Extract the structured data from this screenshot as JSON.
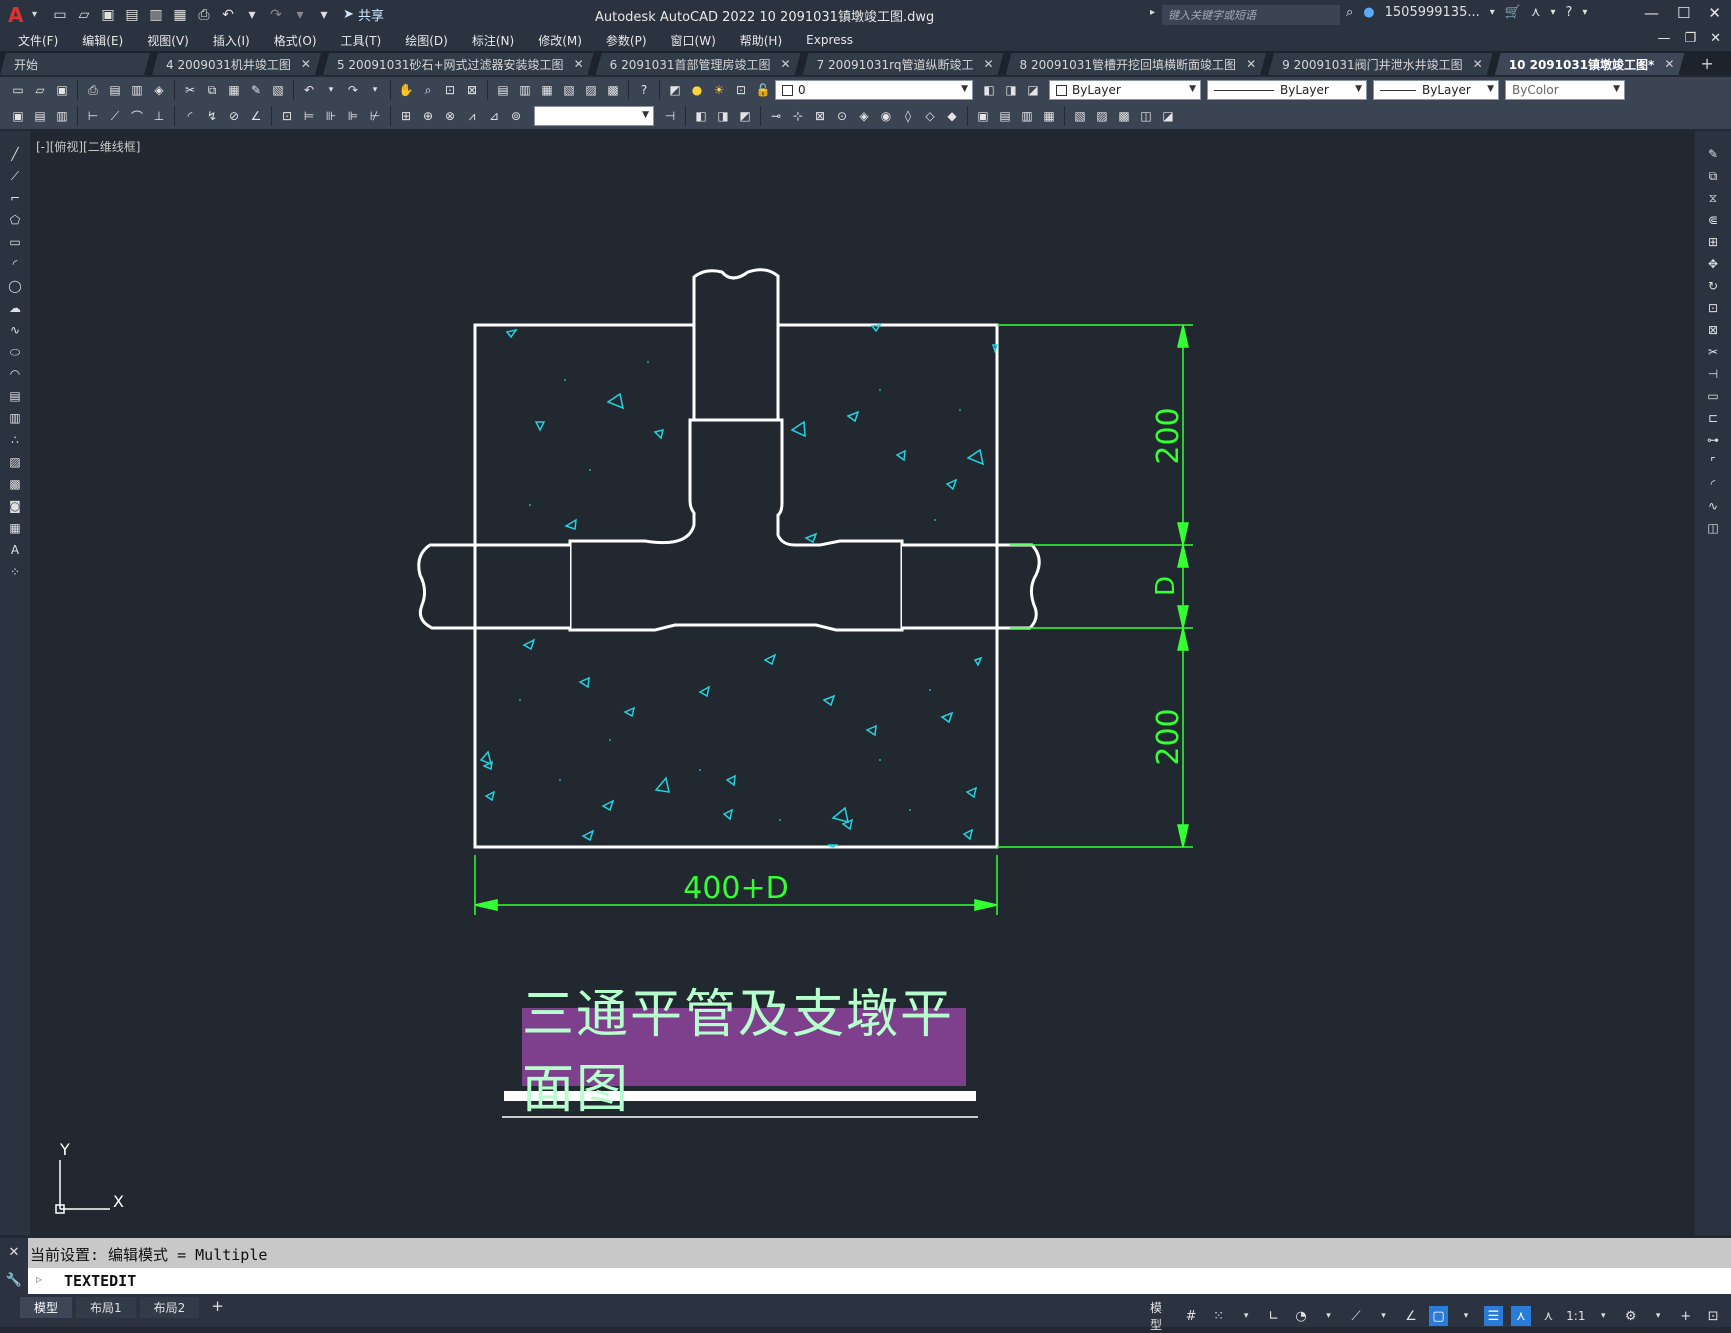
{
  "titlebar": {
    "logo": "A",
    "share": "共享",
    "title": "Autodesk AutoCAD 2022    10  2091031镇墩竣工图.dwg",
    "search_placeholder": "键入关键字或短语",
    "user": "1505999135...",
    "help": "?",
    "cart_icon": "cart-icon"
  },
  "menu": [
    "文件(F)",
    "编辑(E)",
    "视图(V)",
    "插入(I)",
    "格式(O)",
    "工具(T)",
    "绘图(D)",
    "标注(N)",
    "修改(M)",
    "参数(P)",
    "窗口(W)",
    "帮助(H)",
    "Express"
  ],
  "tabs": [
    {
      "label": "开始",
      "close": ""
    },
    {
      "label": "4  2009031机井竣工图",
      "close": "✕"
    },
    {
      "label": "5  20091031砂石+网式过滤器安装竣工图",
      "close": "✕"
    },
    {
      "label": "6  2091031首部管理房竣工图",
      "close": "✕"
    },
    {
      "label": "7  20091031rq管道纵断竣工",
      "close": "✕"
    },
    {
      "label": "8  20091031管槽开挖回填横断面竣工图",
      "close": "✕"
    },
    {
      "label": "9  20091031阀门井泄水井竣工图",
      "close": "✕"
    },
    {
      "label": "10  2091031镇墩竣工图*",
      "close": "✕"
    }
  ],
  "toolbar": {
    "layer_value": "0",
    "color_value": "ByLayer",
    "linetype_value": "ByLayer",
    "lineweight_value": "ByLayer",
    "plotstyle_value": "ByColor"
  },
  "viewport_label": "[-][俯视][二维线框]",
  "drawing": {
    "dim_top": "200",
    "dim_mid": "D",
    "dim_bottom": "200",
    "dim_width": "400+D",
    "title": "三通平管及支墩平面图",
    "ucs_x": "X",
    "ucs_y": "Y",
    "colors": {
      "outline": "#ffffff",
      "dimension": "#33ff33",
      "hatch": "#22d3e0",
      "title_bg": "#7e3f8c",
      "title_text": "#b6ffcc"
    }
  },
  "command": {
    "history": "当前设置: 编辑模式 = Multiple",
    "prompt": "▹",
    "input": "TEXTEDIT"
  },
  "layouts": [
    "模型",
    "布局1",
    "布局2"
  ],
  "status": {
    "model": "模型",
    "scale": "1:1"
  }
}
